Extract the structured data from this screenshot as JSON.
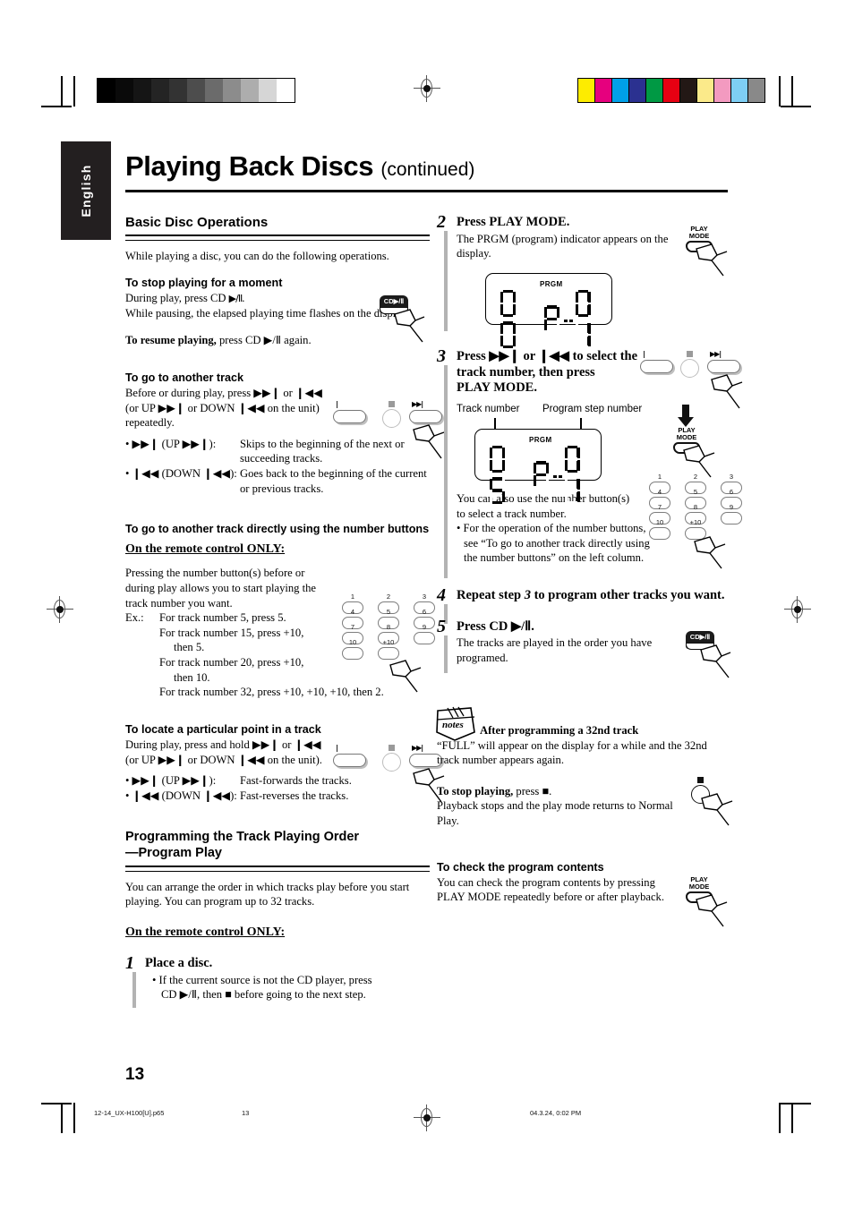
{
  "meta": {
    "language_tab": "English",
    "page_number": "13"
  },
  "header": {
    "title": "Playing Back Discs",
    "title_continued": "(continued)"
  },
  "left_column": {
    "section_title": "Basic Disc Operations",
    "intro": "While playing a disc, you can do the following operations.",
    "stop_moment": {
      "heading": "To stop playing for a moment",
      "line1_pre": "During play, press CD ",
      "line1_sym": "▶/Ⅱ",
      "line1_post": ".",
      "line2": "While pausing, the elapsed playing time flashes on the display.",
      "resume_bold": "To resume playing,",
      "resume_rest": " press CD ▶/Ⅱ again.",
      "button_label": "CD▶/Ⅱ"
    },
    "another_track": {
      "heading": "To go to another track",
      "line1": "Before or during play, press ▶▶❙ or ❙◀◀",
      "line2": "(or UP ▶▶❙ or DOWN ❙◀◀ on the unit)",
      "line3": "repeatedly.",
      "bullets": [
        {
          "key": "• ▶▶❙  (UP ▶▶❙):",
          "value": "Skips to the beginning of the next or succeeding tracks."
        },
        {
          "key": "• ❙◀◀  (DOWN ❙◀◀):",
          "value": "Goes back to the beginning of the current or previous tracks."
        }
      ]
    },
    "number_buttons": {
      "heading": "To go to another track directly using the number buttons",
      "remote_only": "On the remote control ONLY:",
      "para1": "Pressing the number button(s) before or during play allows you to start playing the track number you want.",
      "examples_label": "Ex.:",
      "examples": [
        "For track number 5, press 5.",
        "For track number 15, press +10,",
        "then 5.",
        "For track number 20, press +10,",
        "then 10.",
        "For track number 32, press +10, +10, +10, then 2."
      ],
      "keypad_keys": [
        "1",
        "2",
        "3",
        "4",
        "5",
        "6",
        "7",
        "8",
        "9",
        "10",
        "+10"
      ]
    },
    "locate_point": {
      "heading": "To locate a particular point in a track",
      "line1": "During play, press and hold ▶▶❙ or ❙◀◀",
      "line2": "(or UP ▶▶❙ or DOWN ❙◀◀ on the unit).",
      "bullets": [
        {
          "key": "• ▶▶❙  (UP ▶▶❙):",
          "value": "Fast-forwards the tracks."
        },
        {
          "key": "• ❙◀◀ (DOWN ❙◀◀):",
          "value": "Fast-reverses the tracks."
        }
      ]
    },
    "program_play": {
      "heading_line1": "Programming the Track Playing Order",
      "heading_line2": "—Program Play",
      "para": "You can arrange the order in which tracks play before you start playing. You can program up to 32 tracks.",
      "remote_only": "On the remote control ONLY:",
      "step1": {
        "num": "1",
        "title": "Place a disc.",
        "bullet_line1": "• If the current source is not the CD player, press",
        "bullet_line2": "CD ▶/Ⅱ, then ■ before going to the next step."
      }
    }
  },
  "right_column": {
    "step2": {
      "num": "2",
      "title": "Press PLAY MODE.",
      "body": "The PRGM (program) indicator appears  on the display.",
      "button_label_line1": "PLAY",
      "button_label_line2": "MODE",
      "display": {
        "indicator": "PRGM",
        "track_digits": "00",
        "prefix": "P",
        "step_digits": "01"
      }
    },
    "step3": {
      "num": "3",
      "title_line1": "Press ▶▶❙ or ❙◀◀ to select the",
      "title_line2": "track number, then press",
      "title_line3": "PLAY MODE.",
      "callout_track": "Track number",
      "callout_step": "Program step number",
      "display": {
        "indicator": "PRGM",
        "track_digits": "05",
        "prefix": "P",
        "step_digits": "01"
      },
      "body_line1": "You can also use the number button(s)",
      "body_line2": "to select a track number.",
      "bullet": "• For the operation of the number buttons, see “To go to another track directly using the number buttons” on the left column.",
      "button_label_line1": "PLAY",
      "button_label_line2": "MODE",
      "keypad_keys": [
        "1",
        "2",
        "3",
        "4",
        "5",
        "6",
        "7",
        "8",
        "9",
        "10",
        "+10"
      ]
    },
    "step4": {
      "num": "4",
      "title_pre": "Repeat step ",
      "title_em": "3",
      "title_post": " to program other tracks you want."
    },
    "step5": {
      "num": "5",
      "title": "Press CD ▶/Ⅱ.",
      "body": "The tracks are played in the order you have programed.",
      "button_label": "CD▶/Ⅱ"
    },
    "notes": {
      "icon_word": "notes",
      "heading": "After programming a 32nd track",
      "body": "“FULL” will appear on the display for a while and the 32nd track number appears again.",
      "stop_bold": "To stop playing,",
      "stop_rest": " press ■.",
      "stop_body": "Playback stops and the play mode returns to Normal Play."
    },
    "check_program": {
      "heading": "To check the program contents",
      "body": "You can check the program contents by pressing PLAY MODE repeatedly before or after playback.",
      "button_label_line1": "PLAY",
      "button_label_line2": "MODE"
    }
  },
  "print_marks": {
    "grayscale_steps": [
      "#000000",
      "#0a0a0a",
      "#151515",
      "#242424",
      "#333333",
      "#4d4d4d",
      "#6b6b6b",
      "#8c8c8c",
      "#adadad",
      "#d6d6d6",
      "#ffffff"
    ],
    "color_swatches": [
      "#fdec00",
      "#e6007e",
      "#00a0e9",
      "#2b3190",
      "#009944",
      "#e60012",
      "#231815",
      "#fbea8a",
      "#f39ac0",
      "#7ecef4",
      "#898989"
    ]
  },
  "footer": {
    "filename": "12-14_UX-H100[U].p65",
    "page": "13",
    "timestamp": "04.3.24, 0:02 PM"
  }
}
